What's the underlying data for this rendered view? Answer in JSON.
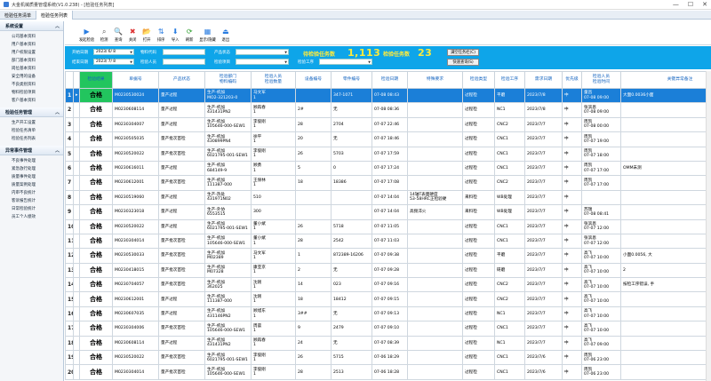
{
  "window": {
    "title": "大金机械质量管理系统(V1.0.238) - [检验任务列表]"
  },
  "tabs": [
    {
      "label": "检验任务清单",
      "active": false
    },
    {
      "label": "检验任务列表",
      "active": true
    }
  ],
  "sidebar": [
    {
      "label": "系统设置",
      "items": [
        "公司基本资料",
        "用户基本资料",
        "用户权限设置",
        "部门基本资料",
        "岗位基本资料",
        "安全用的设备",
        "不良类别资料",
        "物料检验项目",
        "客户基本资料"
      ]
    },
    {
      "label": "检验任务管理",
      "items": [
        "生产开工设置",
        "检验任务清单",
        "检验任务列表"
      ]
    },
    {
      "label": "异常事件管理",
      "items": [
        "不良事件处理",
        "紧急放行处理",
        "质量事件处理",
        "质量案例处理",
        "内审不良统计",
        "客诉报告统计",
        "日常检验统计",
        "员工个人绩效"
      ]
    }
  ],
  "toolbar": [
    "发起检验",
    "检测",
    "查询",
    "关闭",
    "打开",
    "排序",
    "导入",
    "刷新",
    "显示/隐藏",
    "退出"
  ],
  "filter": {
    "start_label": "开始日期",
    "start_value": "2023/ 6/ 8",
    "material_label": "物料代码",
    "material_value": "",
    "status_label": "产品状态",
    "status_value": "",
    "end_label": "结束日期",
    "end_value": "2023/ 7/ 8",
    "inspector_label": "检验人员",
    "inspector_value": "",
    "item_label": "检验项目",
    "item_value": "",
    "process_label": "检验工序",
    "process_value": "",
    "pending_label": "待检验任务数",
    "pending_value": "1,113",
    "inprogress_label": "检验任务数",
    "inprogress_value": "23",
    "btn1": "满空任务栏(C)",
    "btn2": "快速查询(S)"
  },
  "columns": [
    "检验结果",
    "单据号",
    "产品状态",
    "检验部门\n物料编码",
    "检验人员\n检验数量",
    "设备编号",
    "零件编号",
    "检验日期",
    "特殊要求",
    "检验类型",
    "检验工序",
    "需求日期",
    "优先级",
    "检验人员\n检验时间",
    "关键异常备注"
  ],
  "rows": [
    {
      "n": "1",
      "result": "合格",
      "doc": "M0230530024",
      "status": "量产过程",
      "dept": "生产-机加\nMO2-321203-0",
      "insp": "马文军\n1",
      "dev": "",
      "part": "347-1071",
      "date": "07-08 08:43",
      "req": "",
      "type": "过程检",
      "proc": "平磨",
      "due": "2023/7/8",
      "pri": "中",
      "inspt": "童昌\n07-08 09:00",
      "note": "大面0.0036小面",
      "sel": true
    },
    {
      "n": "2",
      "result": "合格",
      "doc": "M0230608114",
      "status": "量产过程",
      "dept": "生产-机加\n431431PN2",
      "insp": "顾再春\n1",
      "dev": "2#",
      "part": "无",
      "date": "07-08 08:36",
      "req": "",
      "type": "过程检",
      "proc": "NC1",
      "due": "2023/7/8",
      "pri": "中",
      "inspt": "张滨恩\n07-08 09:00",
      "note": ""
    },
    {
      "n": "3",
      "result": "合格",
      "doc": "M0230304007",
      "status": "量产过程",
      "dept": "生产-机加\n105646-000-SEW1",
      "insp": "李俊刚\n1",
      "dev": "28",
      "part": "2704",
      "date": "07-07 22:46",
      "req": "",
      "type": "过程检",
      "proc": "CNC2",
      "due": "2023/7/7",
      "pri": "中",
      "inspt": "周凯\n07-08 00:00",
      "note": ""
    },
    {
      "n": "4",
      "result": "合格",
      "doc": "M0230505035",
      "status": "量产批次首检",
      "dept": "生产-机加\n430899PN4",
      "insp": "徐平\n1",
      "dev": "20",
      "part": "无",
      "date": "07-07 18:46",
      "req": "",
      "type": "过程检",
      "proc": "CNC1",
      "due": "2023/7/7",
      "pri": "中",
      "inspt": "周凯\n07-07 19:00",
      "note": ""
    },
    {
      "n": "5",
      "result": "合格",
      "doc": "M0230520022",
      "status": "量产批次首检",
      "dept": "生产-机加\n6021795-001-SEW1",
      "insp": "李俊刚\n1",
      "dev": "26",
      "part": "5703",
      "date": "07-07 17:59",
      "req": "",
      "type": "过程检",
      "proc": "CNC1",
      "due": "2023/7/7",
      "pri": "中",
      "inspt": "周凯\n07-07 18:00",
      "note": ""
    },
    {
      "n": "6",
      "result": "合格",
      "doc": "M0230616011",
      "status": "量产过程",
      "dept": "生产-机加\n684149-9",
      "insp": "顾勇\n1",
      "dev": "5",
      "part": "0",
      "date": "07-07 17:24",
      "req": "",
      "type": "过程检",
      "proc": "CNC1",
      "due": "2023/7/7",
      "pri": "中",
      "inspt": "周凯\n07-07 17:00",
      "note": "OMM未测"
    },
    {
      "n": "7",
      "result": "合格",
      "doc": "M0230612001",
      "status": "量产批次首检",
      "dept": "生产-机加\n111387-000",
      "insp": "王保林\n1",
      "dev": "18",
      "part": "18386",
      "date": "07-07 17:08",
      "req": "",
      "type": "过程检",
      "proc": "CNC2",
      "due": "2023/7/7",
      "pri": "中",
      "inspt": "周凯\n07-07 17:00",
      "note": ""
    },
    {
      "n": "8",
      "result": "合格",
      "doc": "M0230519060",
      "status": "量产过程",
      "dept": "生产-热处\n431971N02",
      "insp": "510",
      "dev": "",
      "part": "",
      "date": "07-07 14:04",
      "req": "14轴T表面硬度\n53-58HRC正检验硬",
      "type": "来料检",
      "proc": "WB处理",
      "due": "2023/7/7",
      "pri": "中",
      "inspt": "",
      "note": ""
    },
    {
      "n": "9",
      "result": "合格",
      "doc": "M0230323018",
      "status": "量产过程",
      "dept": "生产-外协\n6553515",
      "insp": "300",
      "dev": "",
      "part": "",
      "date": "07-07 14:04",
      "req": "高频淬火",
      "type": "来料检",
      "proc": "WB处理",
      "due": "2023/7/7",
      "pri": "中",
      "inspt": "苏瑞\n07-08 08:41",
      "note": ""
    },
    {
      "n": "10",
      "result": "合格",
      "doc": "M0230520022",
      "status": "量产过程",
      "dept": "生产-机加\n6021795-001-SEW1",
      "insp": "董小斌\n1",
      "dev": "26",
      "part": "5718",
      "date": "07-07 11:05",
      "req": "",
      "type": "过程检",
      "proc": "CNC1",
      "due": "2023/7/7",
      "pri": "中",
      "inspt": "张滨恩\n07-07 12:00",
      "note": ""
    },
    {
      "n": "11",
      "result": "合格",
      "doc": "M0230304014",
      "status": "量产批次首检",
      "dept": "生产-机加\n105646-000-SEW1",
      "insp": "董小斌\n1",
      "dev": "28",
      "part": "2542",
      "date": "07-07 11:03",
      "req": "",
      "type": "过程检",
      "proc": "CNC1",
      "due": "2023/7/7",
      "pri": "中",
      "inspt": "张滨恩\n07-07 12:00",
      "note": ""
    },
    {
      "n": "12",
      "result": "合格",
      "doc": "M0230530033",
      "status": "量产批次首检",
      "dept": "生产-机加\nM02389",
      "insp": "马文军\n1",
      "dev": "1",
      "part": "872389-16206",
      "date": "07-07 09:38",
      "req": "",
      "type": "过程检",
      "proc": "平磨",
      "due": "2023/7/7",
      "pri": "中",
      "inspt": "高飞\n07-07 10:00",
      "note": "小面0.0056, 大"
    },
    {
      "n": "13",
      "result": "合格",
      "doc": "M0230418015",
      "status": "量产批次首检",
      "dept": "生产-机加\nM07328",
      "insp": "康亚京\n1",
      "dev": "2",
      "part": "无",
      "date": "07-07 09:28",
      "req": "",
      "type": "过程检",
      "proc": "研磨",
      "due": "2023/7/7",
      "pri": "中",
      "inspt": "高飞\n07-07 10:00",
      "note": "2"
    },
    {
      "n": "14",
      "result": "合格",
      "doc": "M0230704057",
      "status": "量产批次首检",
      "dept": "生产-机加\n362025",
      "insp": "沈刚\n1",
      "dev": "14",
      "part": "023",
      "date": "07-07 09:16",
      "req": "",
      "type": "过程检",
      "proc": "CNC2",
      "due": "2023/7/7",
      "pri": "中",
      "inspt": "高飞\n07-07 10:00",
      "note": "按检工序错误, 手"
    },
    {
      "n": "15",
      "result": "合格",
      "doc": "M0230612001",
      "status": "量产过程",
      "dept": "生产-机加\n111387-000",
      "insp": "沈刚\n1",
      "dev": "18",
      "part": "18412",
      "date": "07-07 09:15",
      "req": "",
      "type": "过程检",
      "proc": "CNC2",
      "due": "2023/7/7",
      "pri": "中",
      "inspt": "高飞\n07-07 10:00",
      "note": ""
    },
    {
      "n": "16",
      "result": "合格",
      "doc": "M0230607035",
      "status": "量产过程",
      "dept": "生产-机加\n431146PN2",
      "insp": "顾旭东\n1",
      "dev": "3##",
      "part": "无",
      "date": "07-07 09:13",
      "req": "",
      "type": "过程检",
      "proc": "NC1",
      "due": "2023/7/7",
      "pri": "中",
      "inspt": "高飞\n07-07 10:00",
      "note": ""
    },
    {
      "n": "17",
      "result": "合格",
      "doc": "M0230304006",
      "status": "量产批次首检",
      "dept": "生产-机加\n105646-000-SEW1",
      "insp": "周晨\n1",
      "dev": "9",
      "part": "2479",
      "date": "07-07 09:10",
      "req": "",
      "type": "过程检",
      "proc": "CNC1",
      "due": "2023/7/7",
      "pri": "中",
      "inspt": "高飞\n07-07 10:00",
      "note": ""
    },
    {
      "n": "18",
      "result": "合格",
      "doc": "M0230608114",
      "status": "量产过程",
      "dept": "生产-机加\n431431PN2",
      "insp": "顾再春\n1",
      "dev": "24",
      "part": "无",
      "date": "07-07 08:39",
      "req": "",
      "type": "过程检",
      "proc": "NC1",
      "due": "2023/7/7",
      "pri": "中",
      "inspt": "高飞\n07-07 09:00",
      "note": ""
    },
    {
      "n": "19",
      "result": "合格",
      "doc": "M0230520022",
      "status": "量产批次首检",
      "dept": "生产-机加\n6021795-001-SEW1",
      "insp": "李俊刚\n1",
      "dev": "26",
      "part": "5715",
      "date": "07-06 18:29",
      "req": "",
      "type": "过程检",
      "proc": "CNC1",
      "due": "2023/7/6",
      "pri": "中",
      "inspt": "周凯\n07-06 23:00",
      "note": ""
    },
    {
      "n": "20",
      "result": "合格",
      "doc": "M0230304014",
      "status": "量产批次首检",
      "dept": "生产-机加\n105646-000-SEW1",
      "insp": "李俊刚\n1",
      "dev": "28",
      "part": "2513",
      "date": "07-06 18:28",
      "req": "",
      "type": "过程检",
      "proc": "CNC1",
      "due": "2023/7/6",
      "pri": "中",
      "inspt": "周凯\n07-06 23:00",
      "note": ""
    }
  ]
}
